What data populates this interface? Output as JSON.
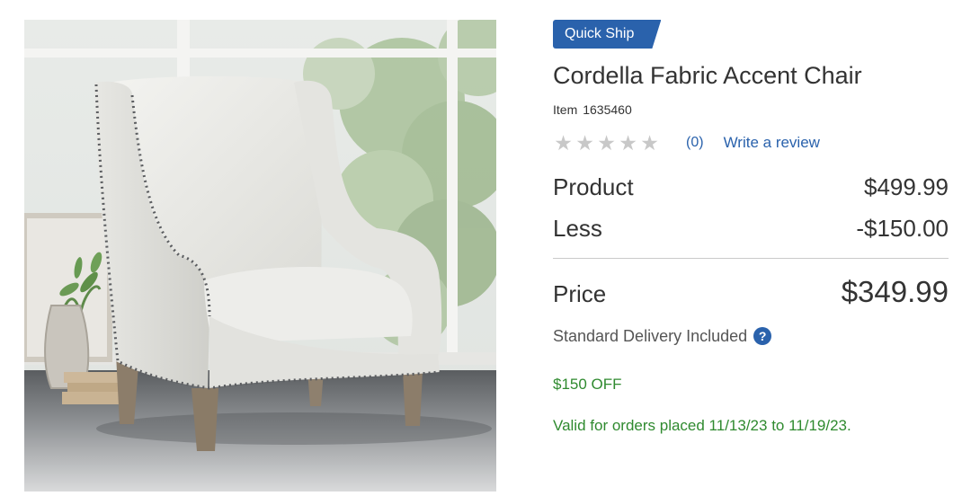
{
  "badge": {
    "label": "Quick Ship",
    "color": "#2a62ac"
  },
  "product": {
    "title": "Cordella Fabric Accent Chair",
    "item_label": "Item",
    "item_number": "1635460",
    "image_alt_icon": "accent-chair-photo"
  },
  "rating": {
    "stars_total": 5,
    "stars_filled": 0,
    "star_glyph": "★",
    "review_count": "(0)",
    "write_review": "Write a review"
  },
  "pricing": {
    "product_label": "Product",
    "product_value": "$499.99",
    "less_label": "Less",
    "less_value": "-$150.00",
    "price_label": "Price",
    "price_value": "$349.99"
  },
  "delivery": {
    "text": "Standard Delivery Included",
    "help_glyph": "?"
  },
  "promo": {
    "off": "$150 OFF",
    "valid": "Valid for orders placed 11/13/23 to 11/19/23.",
    "color": "#2f8a2f"
  }
}
